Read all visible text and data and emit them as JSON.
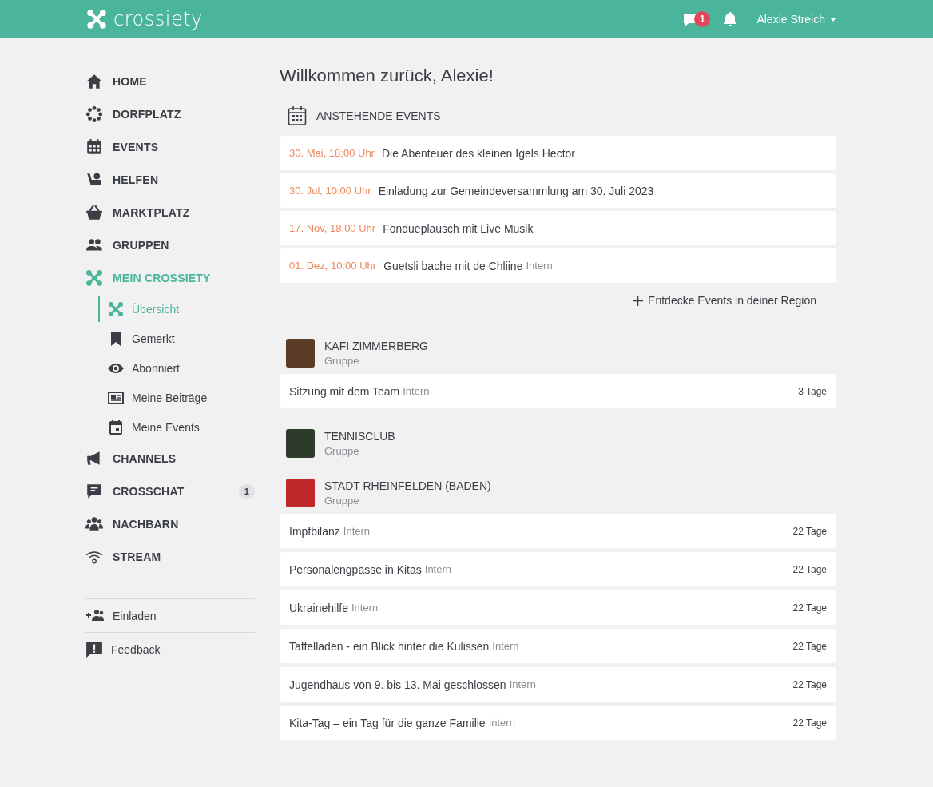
{
  "header": {
    "logo": "crossiety",
    "chat_badge": "1",
    "user": "Alexie Streich"
  },
  "sidebar": {
    "items": [
      {
        "label": "HOME",
        "selected": false
      },
      {
        "label": "DORFPLATZ",
        "selected": false
      },
      {
        "label": "EVENTS",
        "selected": false
      },
      {
        "label": "HELFEN",
        "selected": false
      },
      {
        "label": "MARKTPLATZ",
        "selected": false
      },
      {
        "label": "GRUPPEN",
        "selected": false
      },
      {
        "label": "MEIN CROSSIETY",
        "selected": true,
        "children": [
          {
            "label": "Übersicht",
            "selected": true
          },
          {
            "label": "Gemerkt",
            "selected": false
          },
          {
            "label": "Abonniert",
            "selected": false
          },
          {
            "label": "Meine Beiträge",
            "selected": false
          },
          {
            "label": "Meine Events",
            "selected": false
          }
        ]
      },
      {
        "label": "CHANNELS",
        "selected": false
      },
      {
        "label": "CROSSCHAT",
        "selected": false,
        "badge": "1"
      },
      {
        "label": "NACHBARN",
        "selected": false
      },
      {
        "label": "STREAM",
        "selected": false
      }
    ],
    "footer": [
      {
        "label": "Einladen"
      },
      {
        "label": "Feedback"
      }
    ]
  },
  "main": {
    "title": "Willkommen zurück, Alexie!",
    "events": {
      "heading": "ANSTEHENDE EVENTS",
      "items": [
        {
          "date": "30. Mai, 18:00 Uhr",
          "title": "Die Abenteuer des kleinen Igels Hector"
        },
        {
          "date": "30. Jul, 10:00 Uhr",
          "title": "Einladung zur Gemeindeversammlung am 30. Juli 2023"
        },
        {
          "date": "17. Nov, 18:00 Uhr",
          "title": "Fondueplausch mit Live Musik"
        },
        {
          "date": "01. Dez, 10:00 Uhr",
          "title": "Guetsli bache mit de Chliine",
          "tag": "Intern"
        }
      ],
      "more": "Entdecke Events in deiner Region"
    },
    "groups": [
      {
        "name": "KAFI ZIMMERBERG",
        "type": "Gruppe",
        "posts": [
          {
            "title": "Sitzung mit dem Team",
            "tag": "Intern",
            "age": "3 Tage"
          }
        ]
      },
      {
        "name": "TENNISCLUB",
        "type": "Gruppe"
      },
      {
        "name": "STADT RHEINFELDEN (BADEN)",
        "type": "Gruppe",
        "posts": [
          {
            "title": "Impfbilanz",
            "tag": "Intern",
            "age": "22 Tage"
          },
          {
            "title": "Personalengpässe in Kitas",
            "tag": "Intern",
            "age": "22 Tage"
          },
          {
            "title": "Ukrainehilfe",
            "tag": "Intern",
            "age": "22 Tage"
          },
          {
            "title": "Taffelladen - ein Blick hinter die Kulissen",
            "tag": "Intern",
            "age": "22 Tage"
          },
          {
            "title": "Jugendhaus von 9. bis 13. Mai geschlossen",
            "tag": "Intern",
            "age": "22 Tage"
          },
          {
            "title": "Kita-Tag – ein Tag für die ganze Familie",
            "tag": "Intern",
            "age": "22 Tage"
          }
        ]
      }
    ]
  }
}
